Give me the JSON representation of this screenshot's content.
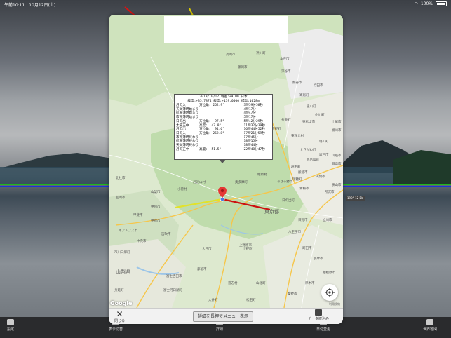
{
  "status_bar": {
    "time": "午前10:11",
    "date": "10月12日(土)",
    "battery": "100%"
  },
  "background": {
    "overlay_label": "190°-12-Bb"
  },
  "toolbar": {
    "items": [
      {
        "label": "設定"
      },
      {
        "label": "表示切替"
      },
      {
        "label": "詳細"
      },
      {
        "label": "日付変更"
      },
      {
        "label": "世界地図"
      }
    ]
  },
  "modal": {
    "close_label": "閉じる",
    "menu_button_label": "詳細を長押でメニュー表示",
    "data_button_label": "データ読込み"
  },
  "map": {
    "google_logo": "Google",
    "terms": "利用規約",
    "prefecture_labels": [
      "山梨県",
      "東京都"
    ],
    "city_labels": [
      "上野原市",
      "大月市",
      "甲州市",
      "甲府市",
      "笛吹市",
      "都留市",
      "富士吉田市",
      "八王子市",
      "青梅市",
      "飯能市",
      "入間市",
      "所沢市",
      "立川市",
      "日の出町",
      "秩父市",
      "小鹿野町",
      "横瀬町",
      "皆野町",
      "長瀞町",
      "寄居町",
      "嵐山町",
      "小川町",
      "東秩父村",
      "ときがわ町",
      "鳩山町",
      "毛呂山町",
      "越生町",
      "日高市",
      "狭山市",
      "坂戸市",
      "川越市",
      "上野原",
      "高崎市",
      "藤岡市",
      "神川町",
      "本庄市",
      "深谷市",
      "熊谷市",
      "行田市",
      "東松山市",
      "桶川市",
      "上尾市",
      "多摩市",
      "相模原市",
      "山梨市",
      "甲斐市",
      "中央市",
      "市川三郷町",
      "身延町",
      "富士河口湖町",
      "北杜市",
      "韮崎市",
      "南アルプス市",
      "道志村",
      "山北町",
      "秦野市",
      "厚木市",
      "町田市",
      "日野市",
      "瑞穂町",
      "あきる野市",
      "檜原村",
      "奥多摩町",
      "丹波山村",
      "小菅村",
      "大井町",
      "松田町"
    ]
  },
  "info_popup": {
    "header_line1": "2019/10/12 時差:+9.00 日本",
    "header_line2": "緯度:+35.7874 経度:+139.0000 標高:1028m",
    "rows": [
      {
        "label": "月の入",
        "detail": "方位角: 262.9°",
        "time": ": 3時59分58秒"
      },
      {
        "label": "天文薄明始まり",
        "detail": "",
        "time": ": 4時17分"
      },
      {
        "label": "航海薄明始まり",
        "detail": "",
        "time": ": 4時47分"
      },
      {
        "label": "市民薄明始まり",
        "detail": "",
        "time": ": 5時17分"
      },
      {
        "label": "日の出",
        "detail": "方位角:  97.5°",
        "time": ": 5時42分29秒"
      },
      {
        "label": "太陽正中",
        "detail": "高度:  47.8°",
        "time": ": 11時32分39秒"
      },
      {
        "label": "月の出",
        "detail": "方位角:  94.6°",
        "time": ": 16時44分52秒"
      },
      {
        "label": "日の入",
        "detail": "方位角: 262.8°",
        "time": ": 17時21分59秒"
      },
      {
        "label": "市民薄明終わり",
        "detail": "",
        "time": ": 17時45分"
      },
      {
        "label": "航海薄明終わり",
        "detail": "",
        "time": ": 18時15分"
      },
      {
        "label": "天文薄明終わり",
        "detail": "",
        "time": ": 18時44分"
      },
      {
        "label": "月の正中",
        "detail": "高度:  51.5°",
        "time": ": 22時48分47秒"
      }
    ]
  }
}
